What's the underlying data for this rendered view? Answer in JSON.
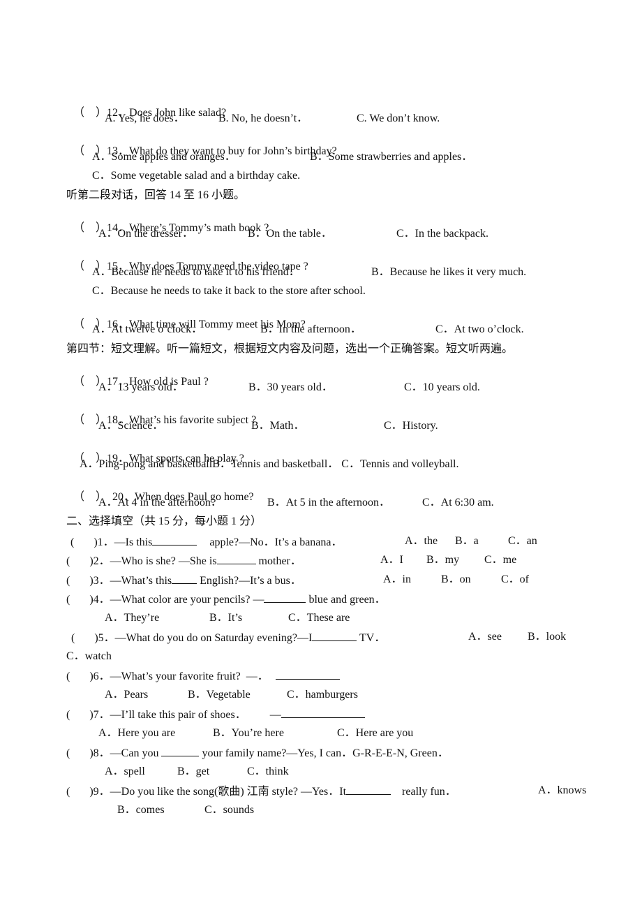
{
  "section_listening": {
    "q12": {
      "paren": "（　）",
      "num": "12．",
      "text": "Does John like salad?",
      "options": [
        "A. Yes, he does．",
        "B. No, he doesn’t．",
        "C. We don’t know."
      ]
    },
    "q13": {
      "paren": "（　）",
      "num": "13．",
      "text": "What do they want to buy for John’s birthday?",
      "options": [
        "A．Some apples and oranges．",
        "B．Some strawberries and apples．",
        "C．Some vegetable salad and a birthday cake."
      ]
    },
    "dialog2_instruction": "听第二段对话，回答 14 至 16 小题。",
    "q14": {
      "paren": "（　）",
      "num": "14．",
      "text": "Where’s Tommy’s math book ?",
      "options": [
        "A．On the dresser．",
        "B．On the table．",
        "C．In the backpack."
      ]
    },
    "q15": {
      "paren": "（　）",
      "num": "15．",
      "text": "Why does Tommy need the video tape ?",
      "options": [
        "A．Because he needs to take it to his friend．",
        "B．Because he likes it very much.",
        "C．Because he needs to take it back to the store after school."
      ]
    },
    "q16": {
      "paren": "（　）",
      "num": "16．",
      "text": "What time will Tommy meet his Mom?",
      "options": [
        "A．At twelve o’clock．",
        "B．In the afternoon．",
        "C．At two o’clock."
      ]
    },
    "section4_instruction": "第四节：短文理解。听一篇短文，根据短文内容及问题，选出一个正确答案。短文听两遍。",
    "q17": {
      "paren": "（　）",
      "num": "17．",
      "text": "How old is Paul ?",
      "options": [
        "A．13 years old．",
        "B．30 years old．",
        "C．10 years old."
      ]
    },
    "q18": {
      "paren": "（　）",
      "num": "18．",
      "text": "What’s his favorite subject ?",
      "options": [
        "A．Science．",
        "B．Math．",
        "C．History."
      ]
    },
    "q19": {
      "paren": "（　）",
      "num": "19．",
      "text": "What sports can he play ?",
      "options": [
        "A．Ping-pong and basketball",
        "B．Tennis and basketball．",
        "C．Tennis and volleyball."
      ]
    },
    "q20": {
      "paren": "（　）",
      "num": "20．",
      "text": "When does Paul go home?",
      "options": [
        "A．At 4 in the afternoon．",
        "B．At 5 in the afternoon．",
        "C．At 6:30 am."
      ]
    }
  },
  "section_fill": {
    "heading": "二、选择填空（共 15 分，每小题 1 分）",
    "q1": {
      "paren": "(",
      "num": ")1．",
      "pre": "—Is this",
      "post": "apple?—No．It’s a banana．",
      "options": [
        "A．the",
        "B．a",
        "C．an"
      ]
    },
    "q2": {
      "paren": "(",
      "num": ")2．",
      "pre": "—Who is she? —She is",
      "post": "mother．",
      "options": [
        "A．I",
        "B．my",
        "C．me"
      ]
    },
    "q3": {
      "paren": "(",
      "num": ")3．",
      "pre": "—What’s this",
      "post": "English?—It’s a bus．",
      "options": [
        "A．in",
        "B．on",
        "C．of"
      ]
    },
    "q4": {
      "paren": "(",
      "num": ")4．",
      "pre": "—What color are your pencils? —",
      "post": "blue and green．",
      "options": [
        "A．They’re",
        "B．It’s",
        "C．These are"
      ]
    },
    "q5": {
      "paren": "(",
      "num": ")5．",
      "pre": "—What do you do on Saturday evening?—I",
      "post": "TV．",
      "options": [
        "A．see",
        "B．look",
        "C．watch"
      ]
    },
    "q6": {
      "paren": "(",
      "num": ")6．",
      "pre": "—What’s your favorite fruit?  —．",
      "post": "",
      "options": [
        "A．Pears",
        "B．Vegetable",
        "C．hamburgers"
      ]
    },
    "q7": {
      "paren": "(",
      "num": ")7．",
      "pre": "—I’ll take this pair of shoes．",
      "post": "—",
      "options": [
        "A．Here you are",
        "B．You’re here",
        "C．Here are you"
      ]
    },
    "q8": {
      "paren": "(",
      "num": ")8．",
      "pre": "—Can you",
      "post": "your family name?—Yes, I can．G-R-E-E-N, Green．",
      "options": [
        "A．spell",
        "B．get",
        "C．think"
      ]
    },
    "q9": {
      "paren": "(",
      "num": ")9．",
      "pre": "—Do you like the song(歌曲) 江南 style? —Yes．It",
      "post": "really fun．",
      "options": [
        "A．knows",
        "B．comes",
        "C．sounds"
      ]
    }
  }
}
